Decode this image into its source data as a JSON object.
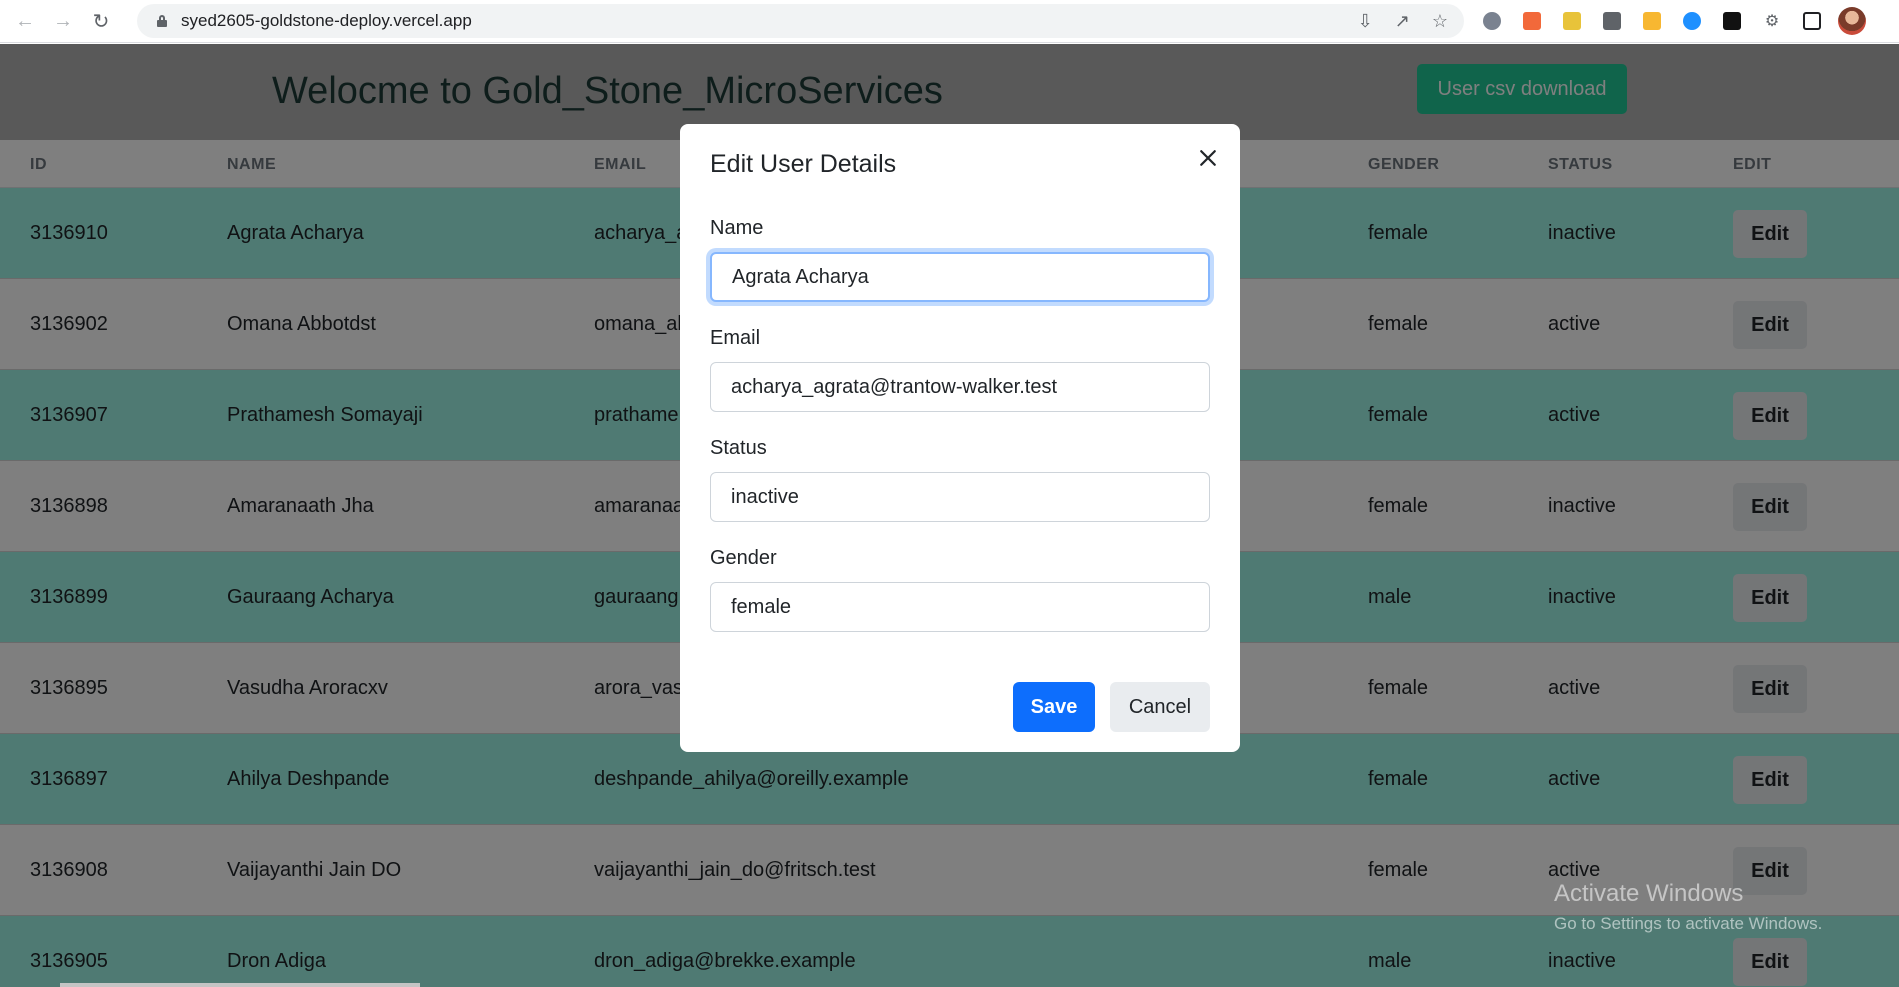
{
  "browser": {
    "url": "syed2605-goldstone-deploy.vercel.app",
    "icons": [
      "back-icon",
      "forward-icon",
      "reload-icon",
      "lock-icon",
      "install-icon",
      "share-icon",
      "star-icon",
      "extensions-icon",
      "side-panel-icon",
      "profile-avatar"
    ]
  },
  "header": {
    "title": "Welocme to Gold_Stone_MicroServices",
    "csv_button": "User csv download"
  },
  "table": {
    "columns": [
      "ID",
      "NAME",
      "EMAIL",
      "GENDER",
      "STATUS",
      "EDIT"
    ],
    "rows": [
      {
        "id": "3136910",
        "name": "Agrata Acharya",
        "email": "acharya_a",
        "gender": "female",
        "status": "inactive",
        "edit": "Edit"
      },
      {
        "id": "3136902",
        "name": "Omana Abbotdst",
        "email": "omana_ab",
        "gender": "female",
        "status": "active",
        "edit": "Edit"
      },
      {
        "id": "3136907",
        "name": "Prathamesh Somayaji",
        "email": "prathame",
        "gender": "female",
        "status": "active",
        "edit": "Edit"
      },
      {
        "id": "3136898",
        "name": "Amaranaath Jha",
        "email": "amaranaa",
        "gender": "female",
        "status": "inactive",
        "edit": "Edit"
      },
      {
        "id": "3136899",
        "name": "Gauraang Acharya",
        "email": "gauraang",
        "gender": "male",
        "status": "inactive",
        "edit": "Edit"
      },
      {
        "id": "3136895",
        "name": "Vasudha Aroracxv",
        "email": "arora_vas",
        "gender": "female",
        "status": "active",
        "edit": "Edit"
      },
      {
        "id": "3136897",
        "name": "Ahilya Deshpande",
        "email": "deshpande_ahilya@oreilly.example",
        "gender": "female",
        "status": "active",
        "edit": "Edit"
      },
      {
        "id": "3136908",
        "name": "Vaijayanthi Jain DO",
        "email": "vaijayanthi_jain_do@fritsch.test",
        "gender": "female",
        "status": "active",
        "edit": "Edit"
      },
      {
        "id": "3136905",
        "name": "Dron Adiga",
        "email": "dron_adiga@brekke.example",
        "gender": "male",
        "status": "inactive",
        "edit": "Edit"
      }
    ]
  },
  "modal": {
    "title": "Edit User Details",
    "name_label": "Name",
    "name_value": "Agrata Acharya",
    "email_label": "Email",
    "email_value": "acharya_agrata@trantow-walker.test",
    "status_label": "Status",
    "status_value": "inactive",
    "gender_label": "Gender",
    "gender_value": "female",
    "save_label": "Save",
    "cancel_label": "Cancel"
  },
  "watermark": {
    "line1": "Activate Windows",
    "line2": "Go to Settings to activate Windows."
  },
  "colors": {
    "accent": "#0d6efd",
    "csv_button": "#20c997",
    "row_tint": "#9ef5e6"
  }
}
